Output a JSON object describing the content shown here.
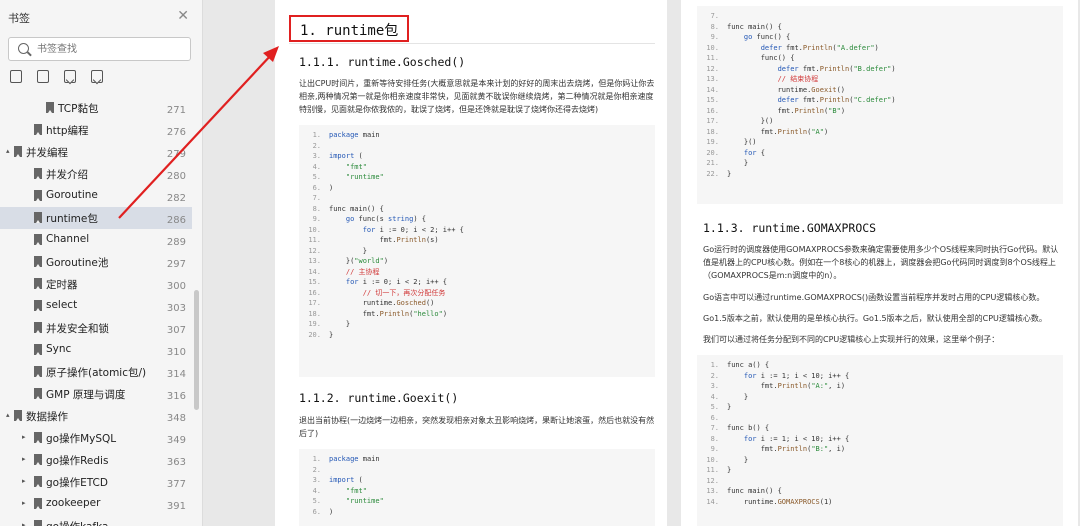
{
  "sidebar": {
    "title": "书签",
    "search_placeholder": "书签查找",
    "items": [
      {
        "label": "TCP黏包",
        "page": "271",
        "level": 2,
        "selected": false,
        "toggle": ""
      },
      {
        "label": "http编程",
        "page": "276",
        "level": 1,
        "selected": false,
        "toggle": ""
      },
      {
        "label": "并发编程",
        "page": "279",
        "level": 0,
        "selected": false,
        "toggle": "▴"
      },
      {
        "label": "并发介绍",
        "page": "280",
        "level": 1,
        "selected": false,
        "toggle": ""
      },
      {
        "label": "Goroutine",
        "page": "282",
        "level": 1,
        "selected": false,
        "toggle": ""
      },
      {
        "label": "runtime包",
        "page": "286",
        "level": 1,
        "selected": true,
        "toggle": ""
      },
      {
        "label": "Channel",
        "page": "289",
        "level": 1,
        "selected": false,
        "toggle": ""
      },
      {
        "label": "Goroutine池",
        "page": "297",
        "level": 1,
        "selected": false,
        "toggle": ""
      },
      {
        "label": "定时器",
        "page": "300",
        "level": 1,
        "selected": false,
        "toggle": ""
      },
      {
        "label": "select",
        "page": "303",
        "level": 1,
        "selected": false,
        "toggle": ""
      },
      {
        "label": "并发安全和锁",
        "page": "307",
        "level": 1,
        "selected": false,
        "toggle": ""
      },
      {
        "label": "Sync",
        "page": "310",
        "level": 1,
        "selected": false,
        "toggle": ""
      },
      {
        "label": "原子操作(atomic包/)",
        "page": "314",
        "level": 1,
        "selected": false,
        "toggle": ""
      },
      {
        "label": "GMP 原理与调度",
        "page": "316",
        "level": 1,
        "selected": false,
        "toggle": ""
      },
      {
        "label": "数据操作",
        "page": "348",
        "level": 0,
        "selected": false,
        "toggle": "▴"
      },
      {
        "label": "go操作MySQL",
        "page": "349",
        "level": 1,
        "selected": false,
        "toggle": "▸"
      },
      {
        "label": "go操作Redis",
        "page": "363",
        "level": 1,
        "selected": false,
        "toggle": "▸"
      },
      {
        "label": "go操作ETCD",
        "page": "377",
        "level": 1,
        "selected": false,
        "toggle": "▸"
      },
      {
        "label": "zookeeper",
        "page": "391",
        "level": 1,
        "selected": false,
        "toggle": "▸"
      },
      {
        "label": "go操作kafka",
        "page": "",
        "level": 1,
        "selected": false,
        "toggle": "▸"
      }
    ]
  },
  "page1": {
    "h1": "1. runtime包",
    "s1_title": "1.1.1. runtime.Gosched()",
    "s1_para": "让出CPU时间片，重新等待安排任务(大概意思就是本来计划的好好的周末出去烧烤，但是你妈让你去相亲,两种情况第一就是你相亲速度非常快，见面就黄不耽误你继续烧烤，第二种情况就是你相亲速度特别慢，见面就是你侬我侬的，耽误了烧烤，但是还馋就是耽误了烧烤你还得去烧烤)",
    "code1": [
      [
        {
          "t": "package",
          "c": "kw"
        },
        {
          "t": " main",
          "c": ""
        }
      ],
      [],
      [
        {
          "t": "import",
          "c": "kw"
        },
        {
          "t": " (",
          "c": ""
        }
      ],
      [
        {
          "t": "    ",
          "c": ""
        },
        {
          "t": "\"fmt\"",
          "c": "str"
        }
      ],
      [
        {
          "t": "    ",
          "c": ""
        },
        {
          "t": "\"runtime\"",
          "c": "str"
        }
      ],
      [
        {
          "t": ")",
          "c": ""
        }
      ],
      [],
      [
        {
          "t": "func main() {",
          "c": ""
        }
      ],
      [
        {
          "t": "    ",
          "c": ""
        },
        {
          "t": "go",
          "c": "kw"
        },
        {
          "t": " func(s ",
          "c": ""
        },
        {
          "t": "string",
          "c": "kw"
        },
        {
          "t": ") {",
          "c": ""
        }
      ],
      [
        {
          "t": "        ",
          "c": ""
        },
        {
          "t": "for",
          "c": "kw"
        },
        {
          "t": " i := 0; i < 2; i++ {",
          "c": ""
        }
      ],
      [
        {
          "t": "            fmt.",
          "c": ""
        },
        {
          "t": "Println",
          "c": "fn"
        },
        {
          "t": "(s)",
          "c": ""
        }
      ],
      [
        {
          "t": "        }",
          "c": ""
        }
      ],
      [
        {
          "t": "    }(",
          "c": ""
        },
        {
          "t": "\"world\"",
          "c": "str"
        },
        {
          "t": ")",
          "c": ""
        }
      ],
      [
        {
          "t": "    ",
          "c": ""
        },
        {
          "t": "// 主协程",
          "c": "cm"
        }
      ],
      [
        {
          "t": "    ",
          "c": ""
        },
        {
          "t": "for",
          "c": "kw"
        },
        {
          "t": " i := 0; i < 2; i++ {",
          "c": ""
        }
      ],
      [
        {
          "t": "        ",
          "c": ""
        },
        {
          "t": "// 切一下，再次分配任务",
          "c": "cm"
        }
      ],
      [
        {
          "t": "        runtime.",
          "c": ""
        },
        {
          "t": "Gosched",
          "c": "fn"
        },
        {
          "t": "()",
          "c": ""
        }
      ],
      [
        {
          "t": "        fmt.",
          "c": ""
        },
        {
          "t": "Println",
          "c": "fn"
        },
        {
          "t": "(",
          "c": ""
        },
        {
          "t": "\"hello\"",
          "c": "str"
        },
        {
          "t": ")",
          "c": ""
        }
      ],
      [
        {
          "t": "    }",
          "c": ""
        }
      ],
      [
        {
          "t": "}",
          "c": ""
        }
      ]
    ],
    "s2_title": "1.1.2. runtime.Goexit()",
    "s2_para": "退出当前协程(一边烧烤一边相亲，突然发现相亲对象太丑影响烧烤，果断让她滚蛋，然后也就没有然后了)",
    "code2": [
      [
        {
          "t": "package",
          "c": "kw"
        },
        {
          "t": " main",
          "c": ""
        }
      ],
      [],
      [
        {
          "t": "import",
          "c": "kw"
        },
        {
          "t": " (",
          "c": ""
        }
      ],
      [
        {
          "t": "    ",
          "c": ""
        },
        {
          "t": "\"fmt\"",
          "c": "str"
        }
      ],
      [
        {
          "t": "    ",
          "c": ""
        },
        {
          "t": "\"runtime\"",
          "c": "str"
        }
      ],
      [
        {
          "t": ")",
          "c": ""
        }
      ]
    ]
  },
  "page2": {
    "code_top_start": 7,
    "code_top": [
      [],
      [
        {
          "t": "func main() {",
          "c": ""
        }
      ],
      [
        {
          "t": "    ",
          "c": ""
        },
        {
          "t": "go",
          "c": "kw"
        },
        {
          "t": " func() {",
          "c": ""
        }
      ],
      [
        {
          "t": "        ",
          "c": ""
        },
        {
          "t": "defer",
          "c": "kw"
        },
        {
          "t": " fmt.",
          "c": ""
        },
        {
          "t": "Println",
          "c": "fn"
        },
        {
          "t": "(",
          "c": ""
        },
        {
          "t": "\"A.defer\"",
          "c": "str"
        },
        {
          "t": ")",
          "c": ""
        }
      ],
      [
        {
          "t": "        func() {",
          "c": ""
        }
      ],
      [
        {
          "t": "            ",
          "c": ""
        },
        {
          "t": "defer",
          "c": "kw"
        },
        {
          "t": " fmt.",
          "c": ""
        },
        {
          "t": "Println",
          "c": "fn"
        },
        {
          "t": "(",
          "c": ""
        },
        {
          "t": "\"B.defer\"",
          "c": "str"
        },
        {
          "t": ")",
          "c": ""
        }
      ],
      [
        {
          "t": "            ",
          "c": ""
        },
        {
          "t": "// 结束协程",
          "c": "cm"
        }
      ],
      [
        {
          "t": "            runtime.",
          "c": ""
        },
        {
          "t": "Goexit",
          "c": "fn"
        },
        {
          "t": "()",
          "c": ""
        }
      ],
      [
        {
          "t": "            ",
          "c": ""
        },
        {
          "t": "defer",
          "c": "kw"
        },
        {
          "t": " fmt.",
          "c": ""
        },
        {
          "t": "Println",
          "c": "fn"
        },
        {
          "t": "(",
          "c": ""
        },
        {
          "t": "\"C.defer\"",
          "c": "str"
        },
        {
          "t": ")",
          "c": ""
        }
      ],
      [
        {
          "t": "            fmt.",
          "c": ""
        },
        {
          "t": "Println",
          "c": "fn"
        },
        {
          "t": "(",
          "c": ""
        },
        {
          "t": "\"B\"",
          "c": "str"
        },
        {
          "t": ")",
          "c": ""
        }
      ],
      [
        {
          "t": "        }()",
          "c": ""
        }
      ],
      [
        {
          "t": "        fmt.",
          "c": ""
        },
        {
          "t": "Println",
          "c": "fn"
        },
        {
          "t": "(",
          "c": ""
        },
        {
          "t": "\"A\"",
          "c": "str"
        },
        {
          "t": ")",
          "c": ""
        }
      ],
      [
        {
          "t": "    }()",
          "c": ""
        }
      ],
      [
        {
          "t": "    ",
          "c": ""
        },
        {
          "t": "for",
          "c": "kw"
        },
        {
          "t": " {",
          "c": ""
        }
      ],
      [
        {
          "t": "    }",
          "c": ""
        }
      ],
      [
        {
          "t": "}",
          "c": ""
        }
      ]
    ],
    "s3_title": "1.1.3. runtime.GOMAXPROCS",
    "p1": "Go运行时的调度器使用GOMAXPROCS参数来确定需要使用多少个OS线程来同时执行Go代码。默认值是机器上的CPU核心数。例如在一个8核心的机器上，调度器会把Go代码同时调度到8个OS线程上（GOMAXPROCS是m:n调度中的n）。",
    "p2": "Go语言中可以通过runtime.GOMAXPROCS()函数设置当前程序并发时占用的CPU逻辑核心数。",
    "p3": "Go1.5版本之前，默认使用的是单核心执行。Go1.5版本之后，默认使用全部的CPU逻辑核心数。",
    "p4": "我们可以通过将任务分配到不同的CPU逻辑核心上实现并行的效果，这里举个例子：",
    "code3": [
      [
        {
          "t": "func a() {",
          "c": ""
        }
      ],
      [
        {
          "t": "    ",
          "c": ""
        },
        {
          "t": "for",
          "c": "kw"
        },
        {
          "t": " i := 1; i < 10; i++ {",
          "c": ""
        }
      ],
      [
        {
          "t": "        fmt.",
          "c": ""
        },
        {
          "t": "Println",
          "c": "fn"
        },
        {
          "t": "(",
          "c": ""
        },
        {
          "t": "\"A:\"",
          "c": "str"
        },
        {
          "t": ", i)",
          "c": ""
        }
      ],
      [
        {
          "t": "    }",
          "c": ""
        }
      ],
      [
        {
          "t": "}",
          "c": ""
        }
      ],
      [],
      [
        {
          "t": "func b() {",
          "c": ""
        }
      ],
      [
        {
          "t": "    ",
          "c": ""
        },
        {
          "t": "for",
          "c": "kw"
        },
        {
          "t": " i := 1; i < 10; i++ {",
          "c": ""
        }
      ],
      [
        {
          "t": "        fmt.",
          "c": ""
        },
        {
          "t": "Println",
          "c": "fn"
        },
        {
          "t": "(",
          "c": ""
        },
        {
          "t": "\"B:\"",
          "c": "str"
        },
        {
          "t": ", i)",
          "c": ""
        }
      ],
      [
        {
          "t": "    }",
          "c": ""
        }
      ],
      [
        {
          "t": "}",
          "c": ""
        }
      ],
      [],
      [
        {
          "t": "func main() {",
          "c": ""
        }
      ],
      [
        {
          "t": "    runtime.",
          "c": ""
        },
        {
          "t": "GOMAXPROCS",
          "c": "fn"
        },
        {
          "t": "(1)",
          "c": ""
        }
      ]
    ]
  },
  "colors": {
    "highlight": "#e02020",
    "keyword": "#2357b5",
    "string": "#2a8a3a",
    "comment": "#d13a3a"
  }
}
